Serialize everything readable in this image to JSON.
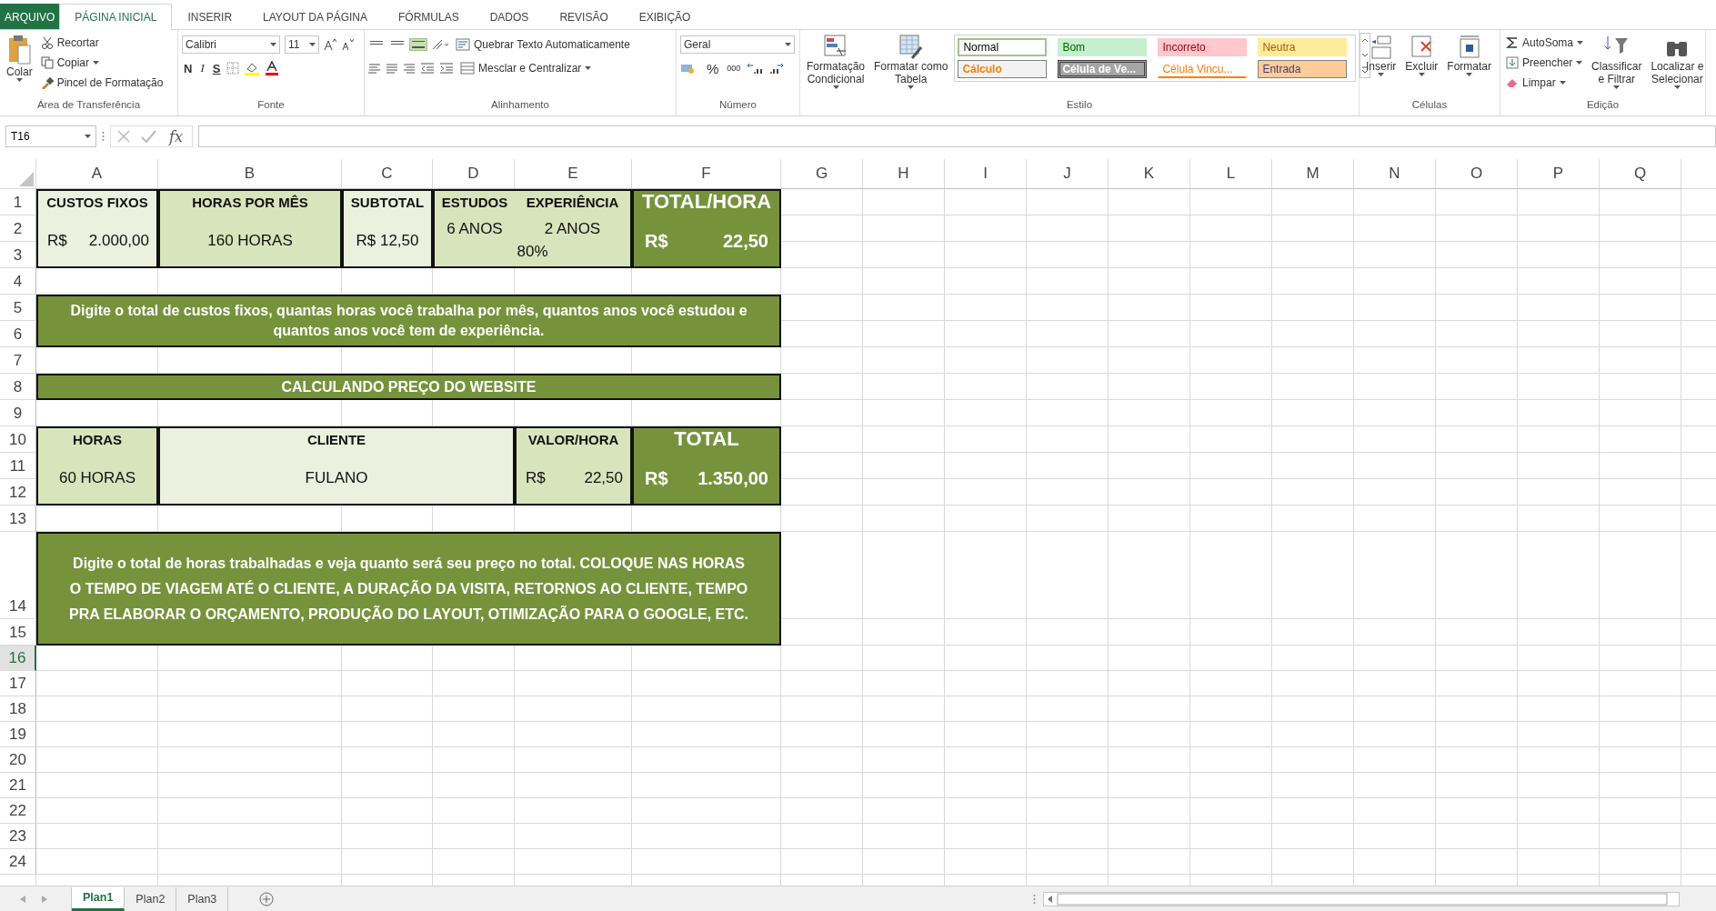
{
  "ribbon": {
    "tabs": [
      {
        "label": "ARQUIVO",
        "kind": "file",
        "selected": false
      },
      {
        "label": "PÁGINA INICIAL",
        "kind": "tab",
        "selected": true
      },
      {
        "label": "INSERIR",
        "kind": "tab",
        "selected": false
      },
      {
        "label": "LAYOUT DA PÁGINA",
        "kind": "tab",
        "selected": false
      },
      {
        "label": "FÓRMULAS",
        "kind": "tab",
        "selected": false
      },
      {
        "label": "DADOS",
        "kind": "tab",
        "selected": false
      },
      {
        "label": "REVISÃO",
        "kind": "tab",
        "selected": false
      },
      {
        "label": "EXIBIÇÃO",
        "kind": "tab",
        "selected": false
      }
    ],
    "clipboard": {
      "label": "Área de Transferência",
      "paste": "Colar",
      "cut": "Recortar",
      "copy": "Copiar",
      "painter": "Pincel de Formatação"
    },
    "font": {
      "label": "Fonte",
      "name": "Calibri",
      "size": "11",
      "bold": "N",
      "italic": "I",
      "underline": "S"
    },
    "alignment": {
      "label": "Alinhamento",
      "wrap": "Quebrar Texto Automaticamente",
      "merge": "Mesclar e Centralizar",
      "vertical": [
        {
          "selected": false
        },
        {
          "selected": false
        },
        {
          "selected": true
        }
      ]
    },
    "number": {
      "label": "Número",
      "format": "Geral",
      "percent": "%",
      "thousands": "000"
    },
    "styles": {
      "label": "Estilo",
      "conditional": [
        "Formatação",
        "Condicional"
      ],
      "table": [
        "Formatar como",
        "Tabela"
      ],
      "presets": [
        {
          "label": "Normal",
          "kind": "normal"
        },
        {
          "label": "Bom",
          "kind": "good"
        },
        {
          "label": "Incorreto",
          "kind": "bad"
        },
        {
          "label": "Neutra",
          "kind": "neutral"
        },
        {
          "label": "Cálculo",
          "kind": "calc"
        },
        {
          "label": "Célula de Ve...",
          "kind": "check"
        },
        {
          "label": "Célula Vincu...",
          "kind": "linked"
        },
        {
          "label": "Entrada",
          "kind": "input"
        }
      ]
    },
    "cells": {
      "label": "Células",
      "insert": "Inserir",
      "delete": "Excluir",
      "format": "Formatar"
    },
    "editing": {
      "label": "Edição",
      "autosum": "AutoSoma",
      "fill": "Preencher",
      "clear": "Limpar",
      "sort": [
        "Classificar",
        "e Filtrar"
      ],
      "find": [
        "Localizar e",
        "Selecionar"
      ]
    }
  },
  "formula_bar": {
    "name_box": "T16",
    "fx": "fx"
  },
  "sheet": {
    "columns": [
      "A",
      "B",
      "C",
      "D",
      "E",
      "F",
      "G",
      "H",
      "I",
      "J",
      "K",
      "L",
      "M",
      "N",
      "O",
      "P",
      "Q"
    ],
    "rows": [
      {
        "label": "1",
        "selected": false
      },
      {
        "label": "2",
        "selected": false
      },
      {
        "label": "3",
        "selected": false
      },
      {
        "label": "4",
        "selected": false
      },
      {
        "label": "5",
        "selected": false
      },
      {
        "label": "6",
        "selected": false
      },
      {
        "label": "7",
        "selected": false
      },
      {
        "label": "8",
        "selected": false
      },
      {
        "label": "9",
        "selected": false
      },
      {
        "label": "10",
        "selected": false
      },
      {
        "label": "11",
        "selected": false
      },
      {
        "label": "12",
        "selected": false
      },
      {
        "label": "13",
        "selected": false
      },
      {
        "label": "14",
        "selected": false
      },
      {
        "label": "15",
        "selected": false
      },
      {
        "label": "16",
        "selected": true
      },
      {
        "label": "17",
        "selected": false
      },
      {
        "label": "18",
        "selected": false
      },
      {
        "label": "19",
        "selected": false
      },
      {
        "label": "20",
        "selected": false
      },
      {
        "label": "21",
        "selected": false
      },
      {
        "label": "22",
        "selected": false
      },
      {
        "label": "23",
        "selected": false
      },
      {
        "label": "24",
        "selected": false
      }
    ],
    "cells": [
      {
        "kind": "header",
        "color": "#ebf1de",
        "text": "CUSTOS FIXOS"
      },
      {
        "kind": "header",
        "color": "#d8e4bc",
        "text": "HORAS POR MÊS"
      },
      {
        "kind": "header",
        "color": "#ebf1de",
        "text": "SUBTOTAL"
      },
      {
        "kind": "header",
        "color": "#d8e4bc",
        "text": "ESTUDOS"
      },
      {
        "kind": "header",
        "color": "#d8e4bc",
        "text": "EXPERIÊNCIA"
      },
      {
        "kind": "title",
        "color": "#76933c",
        "text": "TOTAL/HORA"
      },
      {
        "kind": "money",
        "color": "#ebf1de",
        "currency": "R$",
        "amount": "2.000,00"
      },
      {
        "kind": "value",
        "color": "#d8e4bc",
        "text": "160 HORAS"
      },
      {
        "kind": "value",
        "color": "#ebf1de",
        "text": "R$ 12,50"
      },
      {
        "kind": "value",
        "color": "#d8e4bc",
        "text": "6 ANOS"
      },
      {
        "kind": "value",
        "color": "#d8e4bc",
        "text": "2 ANOS"
      },
      {
        "kind": "value",
        "color": "#d8e4bc",
        "text": "80%"
      },
      {
        "kind": "total",
        "color": "#76933c",
        "currency": "R$",
        "amount": "22,50"
      },
      {
        "kind": "note",
        "color": "#76933c",
        "text": "Digite o total de custos fixos, quantas horas você trabalha por mês, quantos anos você estudou e quantos anos você tem de experiência."
      },
      {
        "kind": "note",
        "color": "#76933c",
        "text": "CALCULANDO PREÇO DO WEBSITE"
      },
      {
        "kind": "header",
        "color": "#d8e4bc",
        "text": "HORAS"
      },
      {
        "kind": "header",
        "color": "#ebf1de",
        "text": "CLIENTE"
      },
      {
        "kind": "header",
        "color": "#d8e4bc",
        "text": "VALOR/HORA"
      },
      {
        "kind": "title",
        "color": "#76933c",
        "text": "TOTAL"
      },
      {
        "kind": "value",
        "color": "#d8e4bc",
        "text": "60 HORAS"
      },
      {
        "kind": "value",
        "color": "#ebf1de",
        "text": "FULANO"
      },
      {
        "kind": "money",
        "color": "#d8e4bc",
        "currency": "R$",
        "amount": "22,50"
      },
      {
        "kind": "total",
        "color": "#76933c",
        "currency": "R$",
        "amount": "1.350,00"
      },
      {
        "kind": "note",
        "color": "#76933c",
        "text": "Digite o total de horas trabalhadas e veja quanto será seu preço no total. COLOQUE NAS HORAS O TEMPO DE VIAGEM ATÉ O CLIENTE, A DURAÇÃO DA VISITA, RETORNOS AO CLIENTE, TEMPO PRA ELABORAR O ORÇAMENTO, PRODUÇÃO DO LAYOUT, OTIMIZAÇÃO PARA O GOOGLE, ETC."
      }
    ]
  },
  "sheet_tabs": [
    {
      "label": "Plan1",
      "selected": true
    },
    {
      "label": "Plan2",
      "selected": false
    },
    {
      "label": "Plan3",
      "selected": false
    }
  ]
}
